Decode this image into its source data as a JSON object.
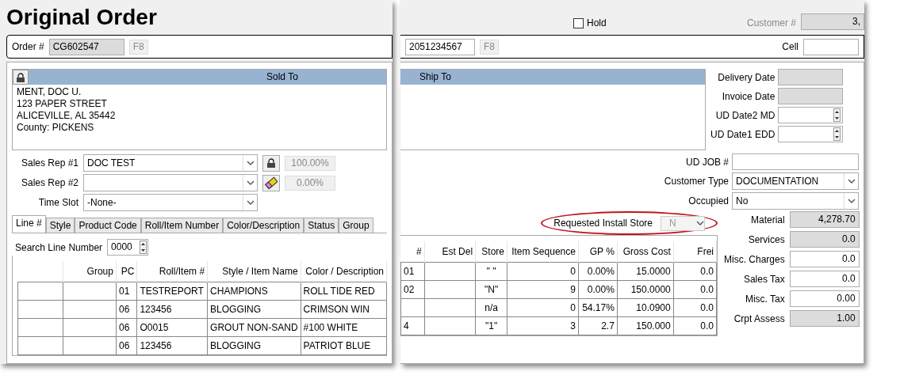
{
  "title": "Original Order",
  "order": {
    "label": "Order #",
    "value": "CG602547",
    "key": "F8"
  },
  "hold": {
    "label": "Hold",
    "checked": false
  },
  "customer": {
    "label": "Customer #",
    "value": "3,"
  },
  "phone": {
    "value": "2051234567",
    "key": "F8"
  },
  "cell": {
    "label": "Cell"
  },
  "sold_to": {
    "title": "Sold To",
    "lines": [
      "MENT, DOC U.",
      "123 PAPER STREET",
      "ALICEVILLE, AL  35442",
      "County: PICKENS"
    ]
  },
  "ship_to": {
    "title": "Ship To"
  },
  "dates": [
    {
      "label": "Delivery Date",
      "kind": "readonly"
    },
    {
      "label": "Invoice Date",
      "kind": "readonly"
    },
    {
      "label": "UD Date2 MD",
      "kind": "spinner"
    },
    {
      "label": "UD Date1 EDD",
      "kind": "spinner"
    }
  ],
  "sales_reps": [
    {
      "label": "Sales Rep #1",
      "value": "DOC TEST",
      "percent": "100.00%",
      "kind": "lock"
    },
    {
      "label": "Sales Rep #2",
      "percent": "0.00%",
      "kind": "eraser"
    }
  ],
  "time_slot": {
    "label": "Time Slot",
    "value": "-None-"
  },
  "fields": [
    {
      "label": "UD JOB #",
      "kind": "text"
    },
    {
      "label": "Customer Type",
      "value": "DOCUMENTATION",
      "kind": "select"
    },
    {
      "label": "Occupied",
      "value": "No",
      "kind": "select"
    }
  ],
  "tabs": [
    {
      "label": "Line #",
      "selected": true
    },
    {
      "label": "Style",
      "selected": false
    },
    {
      "label": "Product Code",
      "selected": false
    },
    {
      "label": "Roll/Item Number",
      "selected": false
    },
    {
      "label": "Color/Description",
      "selected": false
    },
    {
      "label": "Status",
      "selected": false
    },
    {
      "label": "Group",
      "selected": false
    }
  ],
  "search": {
    "label": "Search Line Number",
    "value": "0000"
  },
  "install_store": {
    "label": "Requested Install Store",
    "value": "N",
    "disabled": true,
    "circled": true
  },
  "table": {
    "columns_left": [
      "Group",
      "PC",
      "Roll/Item #",
      "Style / Item Name",
      "Color / Description"
    ],
    "columns_right": [
      "#",
      "Est Del",
      "Store",
      "Item Sequence",
      "GP %",
      "Gross Cost",
      "Frei"
    ],
    "rows": [
      {
        "pc": "01",
        "roll_item": "TESTREPORT",
        "style_item_name": "CHAMPIONS",
        "color_description": "ROLL TIDE RED",
        "number": "01",
        "store": "\" \"",
        "item_sequence": "0",
        "gp": "0.00%",
        "gross_cost": "15.0000",
        "column_13": "0.0"
      },
      {
        "pc": "06",
        "roll_item": "123456",
        "style_item_name": "BLOGGING",
        "color_description": "CRIMSON WIN",
        "number": "02",
        "store": "\"N\"",
        "item_sequence": "9",
        "gp": "0.00%",
        "gross_cost": "150.0000",
        "column_13": "0.0"
      },
      {
        "pc": "06",
        "roll_item": "O0015",
        "style_item_name": "GROUT NON-SAND",
        "color_description": "#100 WHITE",
        "store": "n/a",
        "item_sequence": "0",
        "gp": "54.17%",
        "gross_cost": "10.0900",
        "column_13": "0.0"
      },
      {
        "pc": "06",
        "roll_item": "123456",
        "style_item_name": "BLOGGING",
        "color_description": "PATRIOT BLUE",
        "number": "4",
        "store": "\"1\"",
        "item_sequence": "3",
        "gp": "2.7",
        "gross_cost": "150.000",
        "column_13": "0.0"
      }
    ]
  },
  "totals": [
    {
      "label": "Material",
      "value": "4,278.70",
      "readonly": true
    },
    {
      "label": "Services",
      "value": "0.0",
      "readonly": true
    },
    {
      "label": "Misc. Charges",
      "value": "0.0",
      "readonly": false
    },
    {
      "label": "Sales Tax",
      "value": "0.0",
      "readonly": false
    },
    {
      "label": "Misc. Tax",
      "value": "0.00",
      "readonly": false
    },
    {
      "label": "Crpt Assess",
      "value": "1.00",
      "readonly": true
    }
  ]
}
